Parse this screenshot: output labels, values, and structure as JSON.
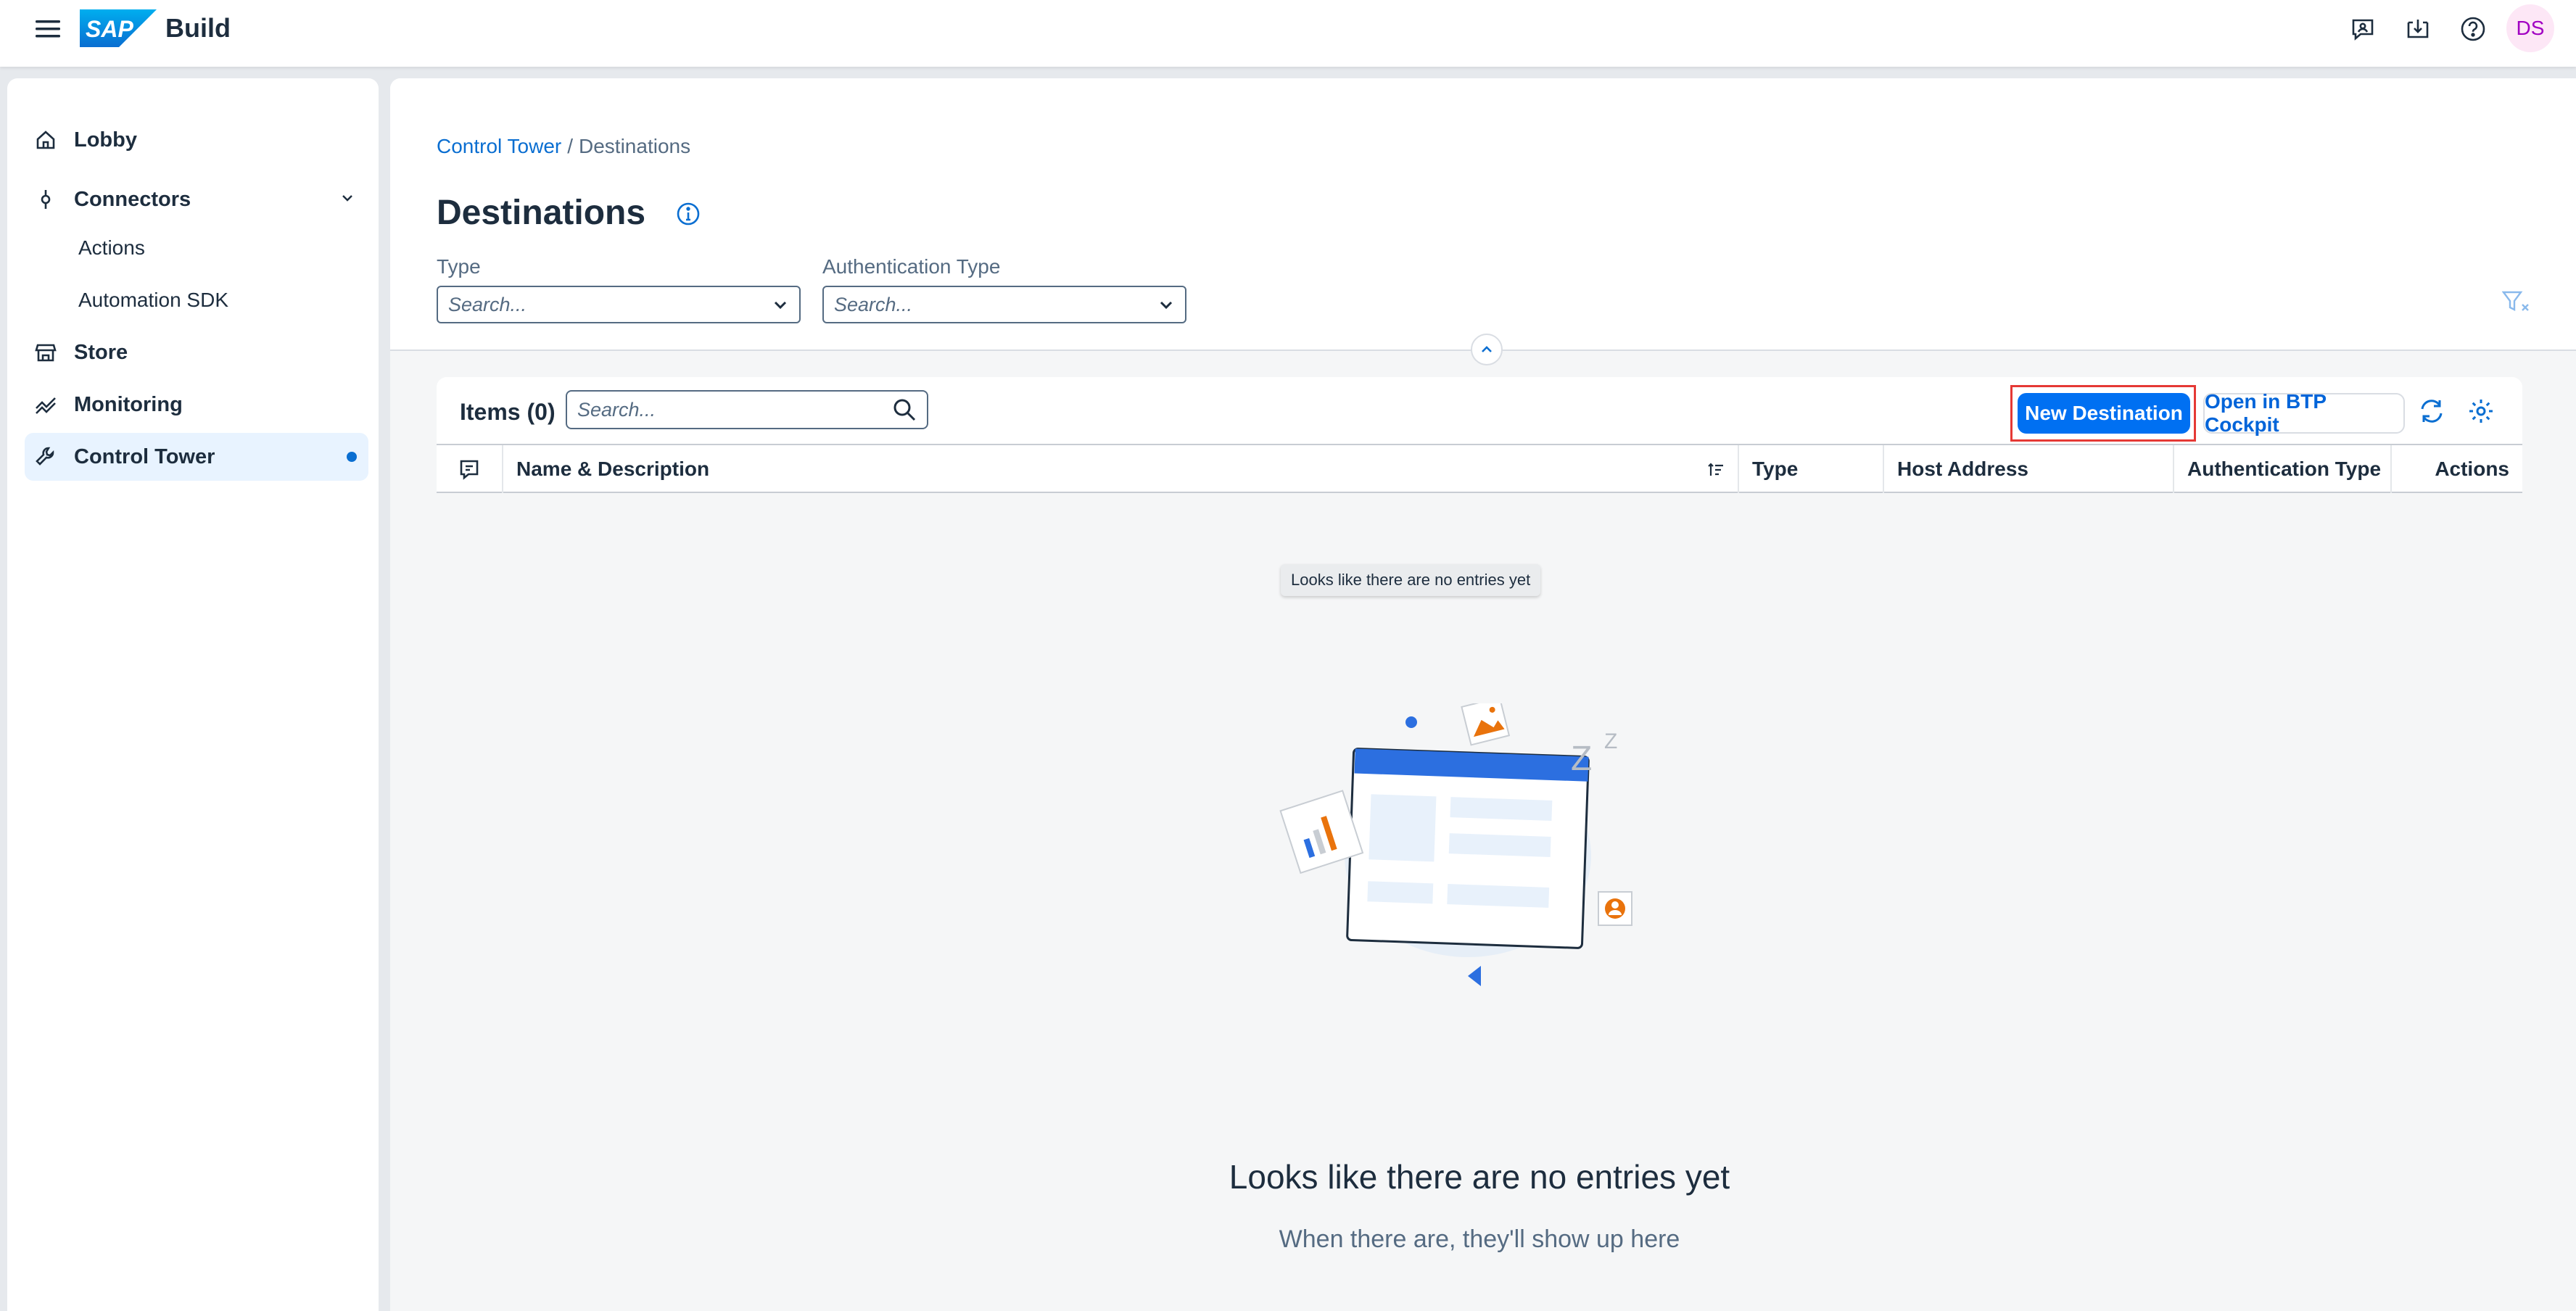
{
  "shell": {
    "brand_logo": "SAP",
    "product": "Build",
    "avatar_initials": "DS",
    "icons": [
      "menu-icon",
      "feedback-icon",
      "notifications-icon",
      "help-icon"
    ]
  },
  "sidebar": {
    "items": [
      {
        "label": "Lobby",
        "icon": "home-icon"
      },
      {
        "label": "Connectors",
        "icon": "connector-icon"
      },
      {
        "label": "Actions"
      },
      {
        "label": "Automation SDK"
      },
      {
        "label": "Store",
        "icon": "store-icon"
      },
      {
        "label": "Monitoring",
        "icon": "monitoring-icon"
      },
      {
        "label": "Control Tower",
        "icon": "wrench-icon",
        "selected": true
      }
    ]
  },
  "breadcrumb": {
    "link": "Control Tower",
    "separator": "/",
    "current": "Destinations"
  },
  "page": {
    "title": "Destinations"
  },
  "filters": {
    "type_label": "Type",
    "type_placeholder": "Search...",
    "auth_label": "Authentication Type",
    "auth_placeholder": "Search..."
  },
  "table": {
    "items_label": "Items (0)",
    "search_placeholder": "Search...",
    "new_button": "New Destination",
    "cockpit_button": "Open in BTP Cockpit",
    "columns": [
      "Name & Description",
      "Type",
      "Host Address",
      "Authentication Type",
      "Actions"
    ]
  },
  "empty_state": {
    "tooltip": "Looks like there are no entries yet",
    "title": "Looks like there are no entries yet",
    "subtitle": "When there are, they'll show up here"
  },
  "colors": {
    "accent": "#0a6ed1",
    "primary_button": "#0070f2",
    "highlight_border": "#e53935",
    "selected_nav": "#e8f3ff"
  }
}
